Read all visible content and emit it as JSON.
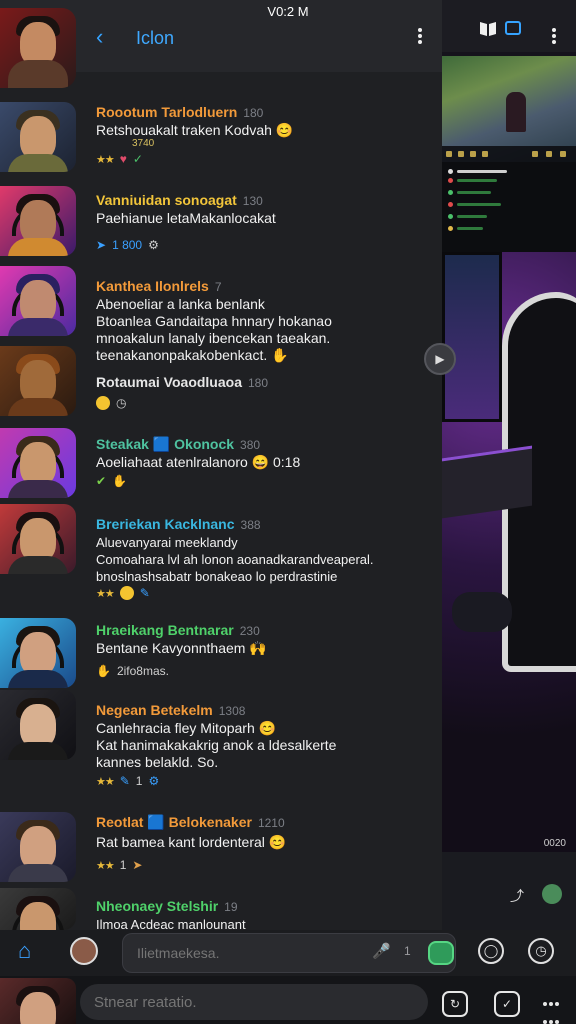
{
  "status_bar": {
    "time": "V0:2 M"
  },
  "header": {
    "title": "Iclon",
    "back_icon": "chevron-left-icon",
    "menu_icon": "more-vertical-icon"
  },
  "messages": [
    {
      "name": "Roootum Tarlodluern",
      "time": "180",
      "name_color": "#f29a3a",
      "text": "Retshouakalt traken Kodvah 😊",
      "reactions": [
        "★★",
        "heart-icon",
        "check-icon"
      ],
      "extra": "3740"
    },
    {
      "name": "Vanniuidan sonoagat",
      "time": "130",
      "name_color": "#f2c53a",
      "text": "Paehianue letaMakanlocakat",
      "reactions": [
        "send-icon",
        "1 800",
        "settings-icon"
      ]
    },
    {
      "name": "Kanthea Ilonlrels",
      "time": "7",
      "name_color": "#f29a3a",
      "text": "Abenoeliar a lanka benlank\nBtoanlea Gandaitapa hnnary hokanao\nmnoakalun lanaly ibencekan taeakan.\nteenakanonpakakobenkact. ✋"
    },
    {
      "name": "Rotaumai Voaodluaoa",
      "time": "180",
      "name_color": "#e6e6e6",
      "text": "",
      "reactions": [
        "emoji",
        "clock-icon"
      ]
    },
    {
      "name": "Steakak 🟦 Okonock",
      "time": "380",
      "name_color": "#4fc3a0",
      "text": "Aoeliahaat atenlralanoro 😄 0:18",
      "reactions": [
        "check-icon",
        "hand-icon"
      ]
    },
    {
      "name": "Breriekan Kacklnanc",
      "time": "388",
      "name_color": "#3ab7e0",
      "text": "Aluevanyarai meeklandy\nComoahara lvl ah lonon aoanadkarandveaperal.\nbnoslnashsabatr bonakeao lo perdrastinie",
      "reactions": [
        "★★",
        "emoji",
        "brush-icon"
      ]
    },
    {
      "name": "Hraeikang Bentnarar",
      "time": "230",
      "name_color": "#4fd16a",
      "text": "Bentane Kavyonnthaem 🙌",
      "extra": "2ifo8mas."
    },
    {
      "name": "Negean Betekelm",
      "time": "1308",
      "name_color": "#f29a3a",
      "text": "Canlehracia fley Mitoparh 😊\nKat hanimakakakrig anok a ldesalkerte\nkannes belakld.  So.",
      "reactions": [
        "★★",
        "brush-icon",
        "1",
        "settings-icon"
      ]
    },
    {
      "name": "Reotlat 🟦 Belokenaker",
      "time": "1210",
      "name_color": "#f29a3a",
      "text": "Rat bamea kant lordenteral 😊",
      "reactions": [
        "★★",
        "1",
        "send-icon"
      ]
    },
    {
      "name": "Nheonaey Stelshir",
      "time": "19",
      "name_color": "#4fd16a",
      "text": "Ilmoa Acdeac manlounant"
    }
  ],
  "composer": {
    "placeholder": "Ilietmaekesa.",
    "count": "1"
  },
  "search": {
    "placeholder": "Stnear reatatio."
  },
  "stream": {
    "viewer_count": "0020"
  },
  "colors": {
    "accent": "#3aa0ff",
    "panel": "#1f2023",
    "emoji_button": "#2f9b5a"
  }
}
